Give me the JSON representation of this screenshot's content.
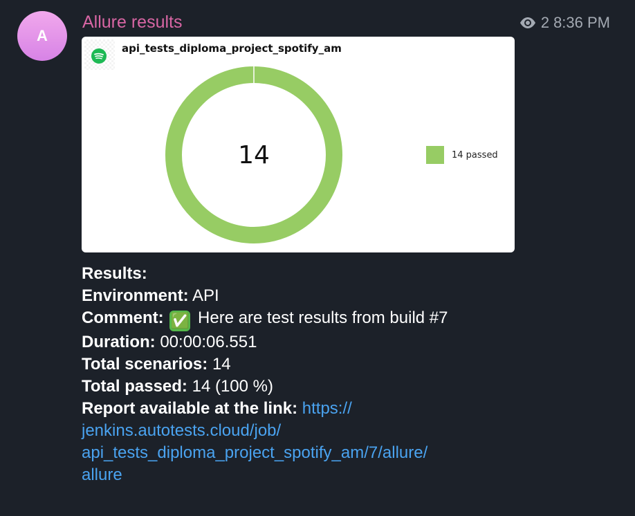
{
  "avatar": {
    "initial": "A",
    "gradient_colors": [
      "#f1a8ec",
      "#d783e6"
    ]
  },
  "sender": {
    "name": "Allure results",
    "color": "#d866a4"
  },
  "meta": {
    "views": "2",
    "time": "8:36 PM",
    "views_icon": "eye-icon"
  },
  "card": {
    "logo_icon": "spotify-icon",
    "title": "api_tests_diploma_project_spotify_am"
  },
  "chart_data": {
    "type": "pie",
    "variant": "donut",
    "center_label": "14",
    "slices": [
      {
        "label": "14 passed",
        "value": 14,
        "color": "#97cc64"
      }
    ],
    "legend_position": "right"
  },
  "message": {
    "results_label": "Results:",
    "environment_label": "Environment:",
    "environment_value": "API",
    "comment_label": "Comment:",
    "comment_emoji": "✅",
    "comment_value": "Here are test results from build #7",
    "duration_label": "Duration:",
    "duration_value": "00:00:06.551",
    "total_scenarios_label": "Total scenarios:",
    "total_scenarios_value": "14",
    "total_passed_label": "Total passed:",
    "total_passed_value": "14 (100 %)",
    "report_label": "Report available at the link:",
    "report_link_lines": [
      "https://",
      "jenkins.autotests.cloud/job/",
      "api_tests_diploma_project_spotify_am/7/allure/",
      "allure"
    ],
    "link_color": "#4aa3f0"
  }
}
